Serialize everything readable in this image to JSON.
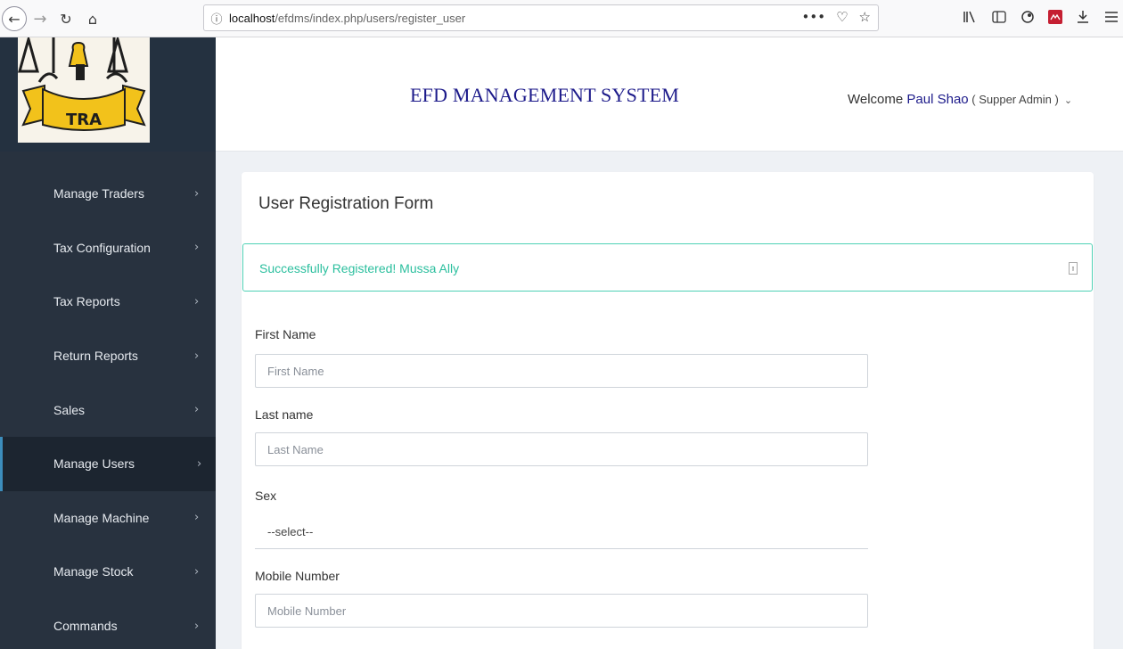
{
  "browser": {
    "url_info": "ⓘ",
    "url_host": "localhost",
    "url_path": "/efdms/index.php/users/register_user",
    "nav": {
      "back": "←",
      "forward": "→",
      "reload": "↻",
      "home": "⌂"
    },
    "url_actions": [
      "•••",
      "♡",
      "☆"
    ],
    "toolbar": [
      "library-icon",
      "sidebar-icon",
      "extension-icon",
      "red-extension-icon",
      "download-icon",
      "menu-icon"
    ]
  },
  "logo": {
    "text": "TRA"
  },
  "header": {
    "title": "EFD MANAGEMENT SYSTEM",
    "welcome_prefix": "Welcome ",
    "user_name": "Paul Shao",
    "user_role": " ( Supper Admin )",
    "caret": "⌄"
  },
  "sidebar": {
    "items": [
      {
        "label": "Manage Traders",
        "active": false
      },
      {
        "label": "Tax Configuration",
        "active": false
      },
      {
        "label": "Tax Reports",
        "active": false
      },
      {
        "label": "Return Reports",
        "active": false
      },
      {
        "label": "Sales",
        "active": false
      },
      {
        "label": "Manage Users",
        "active": true
      },
      {
        "label": "Manage Machine",
        "active": false
      },
      {
        "label": "Manage Stock",
        "active": false
      },
      {
        "label": "Commands",
        "active": false
      }
    ],
    "chevron": "›"
  },
  "form": {
    "title": "User Registration Form",
    "alert_text": "Successfully Registered! Mussa Ally",
    "first_name_label": "First Name",
    "first_name_placeholder": "First Name",
    "last_name_label": "Last name",
    "last_name_placeholder": "Last Name",
    "sex_label": "Sex",
    "sex_value": "--select--",
    "mobile_label": "Mobile Number",
    "mobile_placeholder": "Mobile Number"
  },
  "colors": {
    "sidebar_bg": "#28323f",
    "header_title": "#1c1a8a",
    "alert_border": "#4fd1b5",
    "alert_text": "#2bbf9e",
    "active_indicator": "#3c8dbc"
  }
}
